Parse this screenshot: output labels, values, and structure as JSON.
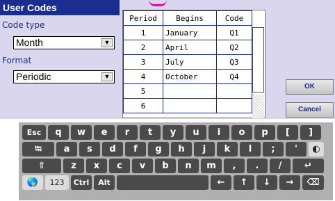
{
  "title": "User Codes",
  "code_type": {
    "label": "Code type",
    "value": "Month"
  },
  "format": {
    "label": "Format",
    "value": "Periodic"
  },
  "table": {
    "headers": [
      "Period",
      "Begins",
      "Code"
    ],
    "rows": [
      [
        "1",
        "January",
        "Q1"
      ],
      [
        "2",
        "April",
        "Q2"
      ],
      [
        "3",
        "July",
        "Q3"
      ],
      [
        "4",
        "October",
        "Q4"
      ],
      [
        "5",
        "",
        ""
      ],
      [
        "6",
        "",
        ""
      ]
    ]
  },
  "buttons": {
    "ok": "OK",
    "cancel": "Cancel"
  },
  "keyboard": {
    "row1": [
      "Esc",
      "q",
      "w",
      "e",
      "r",
      "t",
      "y",
      "u",
      "i",
      "o",
      "p",
      "[",
      "]"
    ],
    "row2": [
      "a",
      "s",
      "d",
      "f",
      "g",
      "h",
      "j",
      "k",
      "l",
      ";",
      "'"
    ],
    "row3": [
      "z",
      "x",
      "c",
      "v",
      "b",
      "n",
      "m",
      ",",
      ".",
      "/"
    ],
    "row4": [
      "123",
      "Ctrl",
      "Alt"
    ],
    "icons": {
      "tab": "⭾",
      "contrast": "◐",
      "shift": "⇧",
      "enter": "↵",
      "globe": "🌎",
      "left": "←",
      "up": "↑",
      "down": "↓",
      "right": "→",
      "backspace": "⌫"
    }
  }
}
